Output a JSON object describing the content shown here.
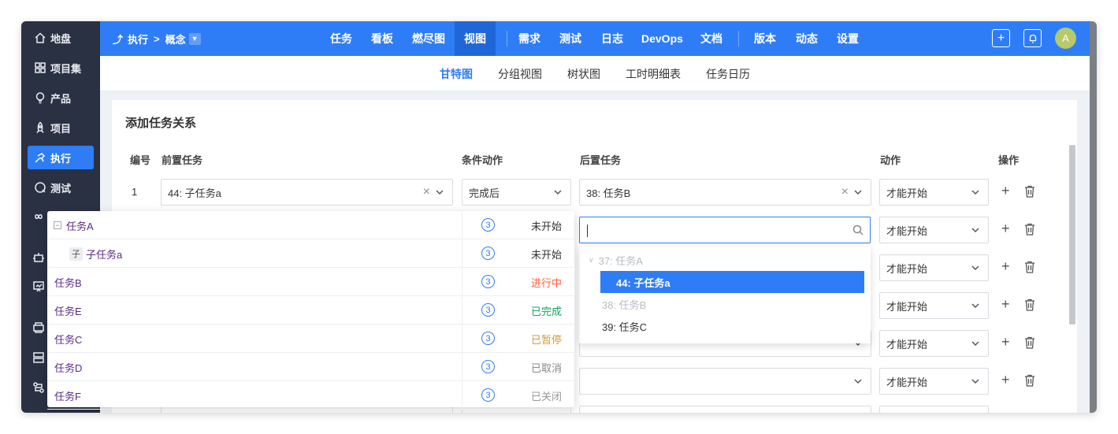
{
  "sidebar": {
    "items": [
      {
        "label": "地盘",
        "icon": "home-icon"
      },
      {
        "label": "项目集",
        "icon": "grid-icon"
      },
      {
        "label": "产品",
        "icon": "bulb-icon"
      },
      {
        "label": "项目",
        "icon": "rocket-icon"
      },
      {
        "label": "执行",
        "icon": "run-icon"
      },
      {
        "label": "测试",
        "icon": "test-icon"
      }
    ],
    "more_icons": [
      "infinity-icon",
      "robot-icon",
      "board-icon",
      "printer-icon",
      "server-icon",
      "flow-icon"
    ]
  },
  "topbar": {
    "crumb_root": "执行",
    "crumb_sep": ">",
    "crumb_current": "概念",
    "nav": [
      "任务",
      "看板",
      "燃尽图",
      "视图",
      "需求",
      "测试",
      "日志",
      "DevOps",
      "文档",
      "版本",
      "动态",
      "设置"
    ],
    "active_nav": "视图",
    "add_btn": "+",
    "avatar": "A"
  },
  "subnav": {
    "items": [
      "甘特图",
      "分组视图",
      "树状图",
      "工时明细表",
      "任务日历"
    ],
    "active": "甘特图"
  },
  "panel": {
    "title": "添加任务关系",
    "headers": {
      "num": "编号",
      "pre": "前置任务",
      "cond": "条件动作",
      "post": "后置任务",
      "action": "动作",
      "ops": "操作"
    },
    "row1": {
      "num": "1",
      "pre": "44: 子任务a",
      "cond": "完成后",
      "post": "38: 任务B",
      "action": "才能开始"
    },
    "action_default": "才能开始",
    "add_symbol": "+"
  },
  "pre_dropdown": {
    "rows": [
      {
        "name": "任务A",
        "count": "3",
        "status": "未开始",
        "status_color": "#333333"
      },
      {
        "name": "子任务a",
        "count": "3",
        "status": "未开始",
        "status_color": "#333333"
      },
      {
        "name": "任务B",
        "count": "3",
        "status": "进行中",
        "status_color": "#ff5d3b"
      },
      {
        "name": "任务E",
        "count": "3",
        "status": "已完成",
        "status_color": "#17a05d"
      },
      {
        "name": "任务C",
        "count": "3",
        "status": "已暂停",
        "status_color": "#cf9c3b"
      },
      {
        "name": "任务D",
        "count": "3",
        "status": "已取消",
        "status_color": "#888888"
      },
      {
        "name": "任务F",
        "count": "3",
        "status": "已关闭",
        "status_color": "#999999"
      }
    ],
    "child_tag": "子",
    "collapse_symbol": "−"
  },
  "post_dropdown": {
    "search_value": "",
    "items": [
      {
        "label": "37: 任务A",
        "state": "disabled"
      },
      {
        "label": "44: 子任务a",
        "state": "selected"
      },
      {
        "label": "38: 任务B",
        "state": "disabled"
      },
      {
        "label": "39: 任务C",
        "state": "normal"
      }
    ]
  },
  "colors": {
    "primary": "#2e7df6",
    "sidebar": "#2a3142",
    "active_nav": "#1f67d8"
  }
}
